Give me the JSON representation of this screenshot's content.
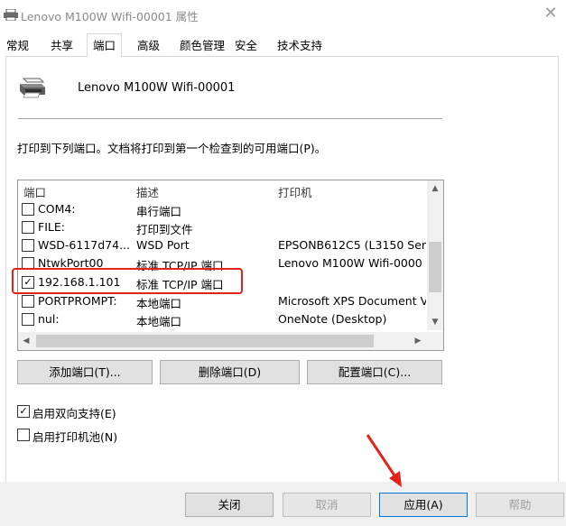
{
  "window": {
    "title": "Lenovo M100W Wifi-00001 属性",
    "close_icon": "close-icon"
  },
  "tabs": [
    {
      "label": "常规"
    },
    {
      "label": "共享"
    },
    {
      "label": "端口",
      "active": true
    },
    {
      "label": "高级"
    },
    {
      "label": "颜色管理"
    },
    {
      "label": "安全"
    },
    {
      "label": "技术支持"
    }
  ],
  "printer": {
    "name": "Lenovo M100W Wifi-00001"
  },
  "instruction": "打印到下列端口。文档将打印到第一个检查到的可用端口(P)。",
  "ports": {
    "headers": {
      "port": "端口",
      "description": "描述",
      "printer": "打印机"
    },
    "rows": [
      {
        "port": "COM4:",
        "description": "串行端口",
        "printer": "",
        "checked": false
      },
      {
        "port": "FILE:",
        "description": "打印到文件",
        "printer": "",
        "checked": false
      },
      {
        "port": "WSD-6117d74...",
        "description": "WSD Port",
        "printer": "EPSONB612C5 (L3150 Ser",
        "checked": false
      },
      {
        "port": "NtwkPort00",
        "description": "标准 TCP/IP 端口",
        "printer": "Lenovo M100W Wifi-0000",
        "checked": false
      },
      {
        "port": "192.168.1.101",
        "description": "标准 TCP/IP 端口",
        "printer": "",
        "checked": true
      },
      {
        "port": "PORTPROMPT:",
        "description": "本地端口",
        "printer": "Microsoft XPS Document V",
        "checked": false
      },
      {
        "port": "nul:",
        "description": "本地端口",
        "printer": "OneNote (Desktop)",
        "checked": false
      }
    ]
  },
  "port_buttons": {
    "add": "添加端口(T)...",
    "delete": "删除端口(D)",
    "configure": "配置端口(C)..."
  },
  "options": {
    "bidirectional": {
      "label": "启用双向支持(E)",
      "checked": true
    },
    "pooling": {
      "label": "启用打印机池(N)",
      "checked": false
    }
  },
  "footer": {
    "close": "关闭",
    "cancel": "取消",
    "apply": "应用(A)",
    "help": "帮助"
  },
  "colors": {
    "highlight": "#e2231a",
    "annotation_arrow": "#e2231a"
  }
}
